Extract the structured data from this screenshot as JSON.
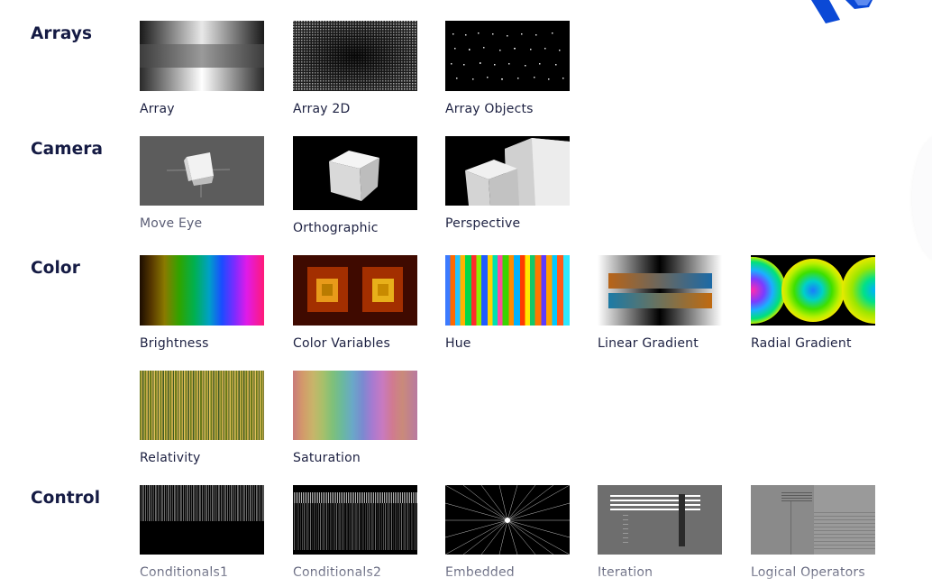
{
  "sections": {
    "arrays": {
      "title": "Arrays",
      "items": [
        "Array",
        "Array 2D",
        "Array Objects"
      ]
    },
    "camera": {
      "title": "Camera",
      "items": [
        "Move Eye",
        "Orthographic",
        "Perspective"
      ]
    },
    "color": {
      "title": "Color",
      "items": [
        "Brightness",
        "Color Variables",
        "Hue",
        "Linear Gradient",
        "Radial Gradient",
        "Relativity",
        "Saturation"
      ]
    },
    "control": {
      "title": "Control",
      "items": [
        "Conditionals1",
        "Conditionals2",
        "Embedded",
        "Iteration",
        "Logical Operators"
      ]
    }
  },
  "colors": {
    "heading": "#151b44",
    "label": "#1d2142",
    "muted_label": "#5a5d75",
    "logo_blue": "#0b49d6"
  },
  "icons": {
    "logo": "processing-logo-icon"
  }
}
